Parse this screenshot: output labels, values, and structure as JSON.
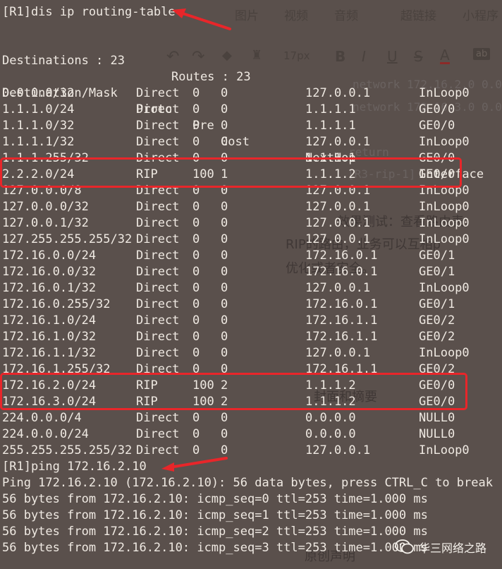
{
  "background_editor": {
    "menu": [
      "图片",
      "视频",
      "音频",
      "超链接",
      "小程序"
    ],
    "font_size": "17px",
    "snippets": [
      {
        "text": "network 172.16.2.0 0.0"
      },
      {
        "text": "network 172.16.3.0 0.0"
      },
      {
        "text": "return"
      },
      {
        "text": "[R3-rip-1]"
      },
      {
        "text": "效果测试：查看路由表，"
      },
      {
        "text": "RIP的路由，业务可以互相p"
      },
      {
        "text": "优化或者安全。"
      },
      {
        "text": "封面和摘要"
      },
      {
        "text": "原创声明"
      }
    ]
  },
  "terminal": {
    "cmd1": "[R1]dis ip routing-table",
    "summary": {
      "destinations": "Destinations : 23",
      "routes": "Routes : 23"
    },
    "headers": [
      "Destination/Mask",
      "Proto",
      "Pre",
      "Cost",
      "NextHop",
      "Interface"
    ],
    "rows": [
      [
        "0.0.0.0/32",
        "Direct",
        "0",
        "0",
        "127.0.0.1",
        "InLoop0"
      ],
      [
        "1.1.1.0/24",
        "Direct",
        "0",
        "0",
        "1.1.1.1",
        "GE0/0"
      ],
      [
        "1.1.1.0/32",
        "Direct",
        "0",
        "0",
        "1.1.1.1",
        "GE0/0"
      ],
      [
        "1.1.1.1/32",
        "Direct",
        "0",
        "0",
        "127.0.0.1",
        "InLoop0"
      ],
      [
        "1.1.1.255/32",
        "Direct",
        "0",
        "0",
        "1.1.1.1",
        "GE0/0"
      ],
      [
        "2.2.2.0/24",
        "RIP",
        "100",
        "1",
        "1.1.1.2",
        "GE0/0"
      ],
      [
        "127.0.0.0/8",
        "Direct",
        "0",
        "0",
        "127.0.0.1",
        "InLoop0"
      ],
      [
        "127.0.0.0/32",
        "Direct",
        "0",
        "0",
        "127.0.0.1",
        "InLoop0"
      ],
      [
        "127.0.0.1/32",
        "Direct",
        "0",
        "0",
        "127.0.0.1",
        "InLoop0"
      ],
      [
        "127.255.255.255/32",
        "Direct",
        "0",
        "0",
        "127.0.0.1",
        "InLoop0"
      ],
      [
        "172.16.0.0/24",
        "Direct",
        "0",
        "0",
        "172.16.0.1",
        "GE0/1"
      ],
      [
        "172.16.0.0/32",
        "Direct",
        "0",
        "0",
        "172.16.0.1",
        "GE0/1"
      ],
      [
        "172.16.0.1/32",
        "Direct",
        "0",
        "0",
        "127.0.0.1",
        "InLoop0"
      ],
      [
        "172.16.0.255/32",
        "Direct",
        "0",
        "0",
        "172.16.0.1",
        "GE0/1"
      ],
      [
        "172.16.1.0/24",
        "Direct",
        "0",
        "0",
        "172.16.1.1",
        "GE0/2"
      ],
      [
        "172.16.1.0/32",
        "Direct",
        "0",
        "0",
        "172.16.1.1",
        "GE0/2"
      ],
      [
        "172.16.1.1/32",
        "Direct",
        "0",
        "0",
        "127.0.0.1",
        "InLoop0"
      ],
      [
        "172.16.1.255/32",
        "Direct",
        "0",
        "0",
        "172.16.1.1",
        "GE0/2"
      ],
      [
        "172.16.2.0/24",
        "RIP",
        "100",
        "2",
        "1.1.1.2",
        "GE0/0"
      ],
      [
        "172.16.3.0/24",
        "RIP",
        "100",
        "2",
        "1.1.1.2",
        "GE0/0"
      ],
      [
        "224.0.0.0/4",
        "Direct",
        "0",
        "0",
        "0.0.0.0",
        "NULL0"
      ],
      [
        "224.0.0.0/24",
        "Direct",
        "0",
        "0",
        "0.0.0.0",
        "NULL0"
      ],
      [
        "255.255.255.255/32",
        "Direct",
        "0",
        "0",
        "127.0.0.1",
        "InLoop0"
      ]
    ],
    "cmd2": "[R1]ping 172.16.2.10",
    "ping_lines": [
      "Ping 172.16.2.10 (172.16.2.10): 56 data bytes, press CTRL_C to break",
      "56 bytes from 172.16.2.10: icmp_seq=0 ttl=253 time=1.000 ms",
      "56 bytes from 172.16.2.10: icmp_seq=1 ttl=253 time=1.000 ms",
      "56 bytes from 172.16.2.10: icmp_seq=2 ttl=253 time=1.000 ms",
      "56 bytes from 172.16.2.10: icmp_seq=3 ttl=253 time=1.000 ms"
    ]
  },
  "highlight_color": "#e8262a",
  "watermark": {
    "text": "华三网络之路",
    "icon": "wechat-icon"
  }
}
